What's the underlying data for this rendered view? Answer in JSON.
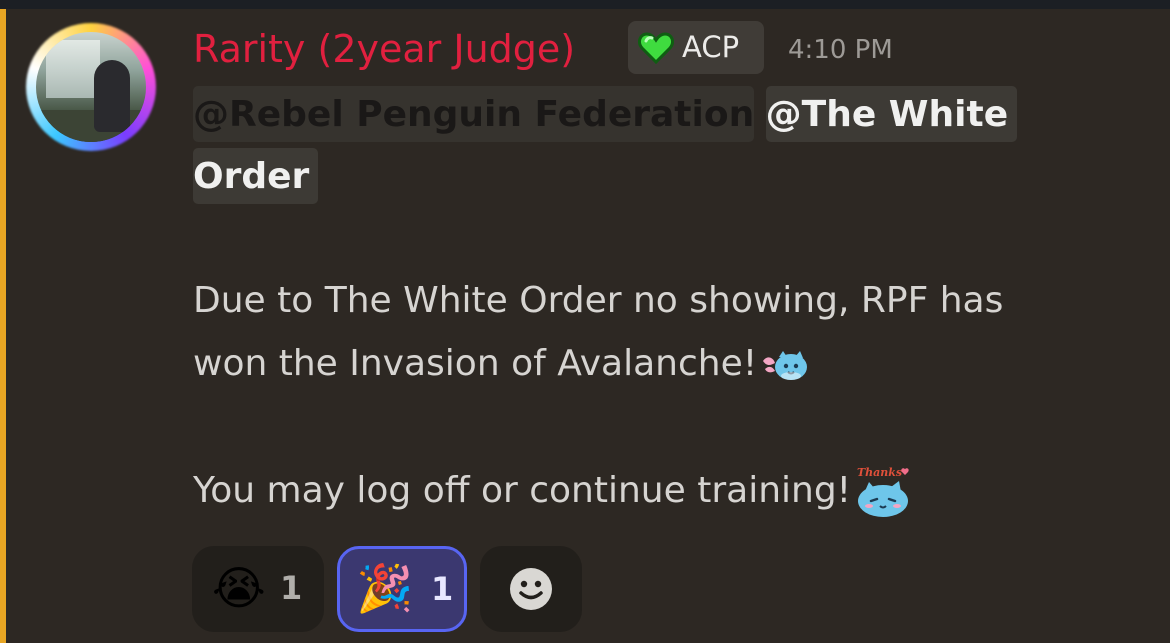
{
  "message": {
    "author": "Rarity (2year Judge)",
    "role_tag": {
      "label": "ACP",
      "icon": "green-heart-icon"
    },
    "timestamp": "4:10 PM",
    "mentions": [
      "@Rebel Penguin Federation",
      "@The White Order"
    ],
    "lines": [
      "Due to The White Order no showing, RPF has",
      "won the Invasion of Avalanche!",
      "You may log off or continue training!"
    ],
    "emotes": [
      {
        "name": "blue-cat-flying-emote"
      },
      {
        "name": "blue-cat-thanks-emote",
        "text": "Thanks"
      }
    ]
  },
  "reactions": [
    {
      "emoji": "😭",
      "icon": "loudly-crying-face-icon",
      "count": "1",
      "active": false
    },
    {
      "emoji": "🎉",
      "icon": "party-popper-icon",
      "count": "1",
      "active": true
    },
    {
      "icon": "add-reaction-smiley-icon"
    }
  ],
  "colors": {
    "background": "#2d2823",
    "mention_bar": "#e8a623",
    "author_name": "#e1203f",
    "active_reaction_border": "#5865f2"
  }
}
